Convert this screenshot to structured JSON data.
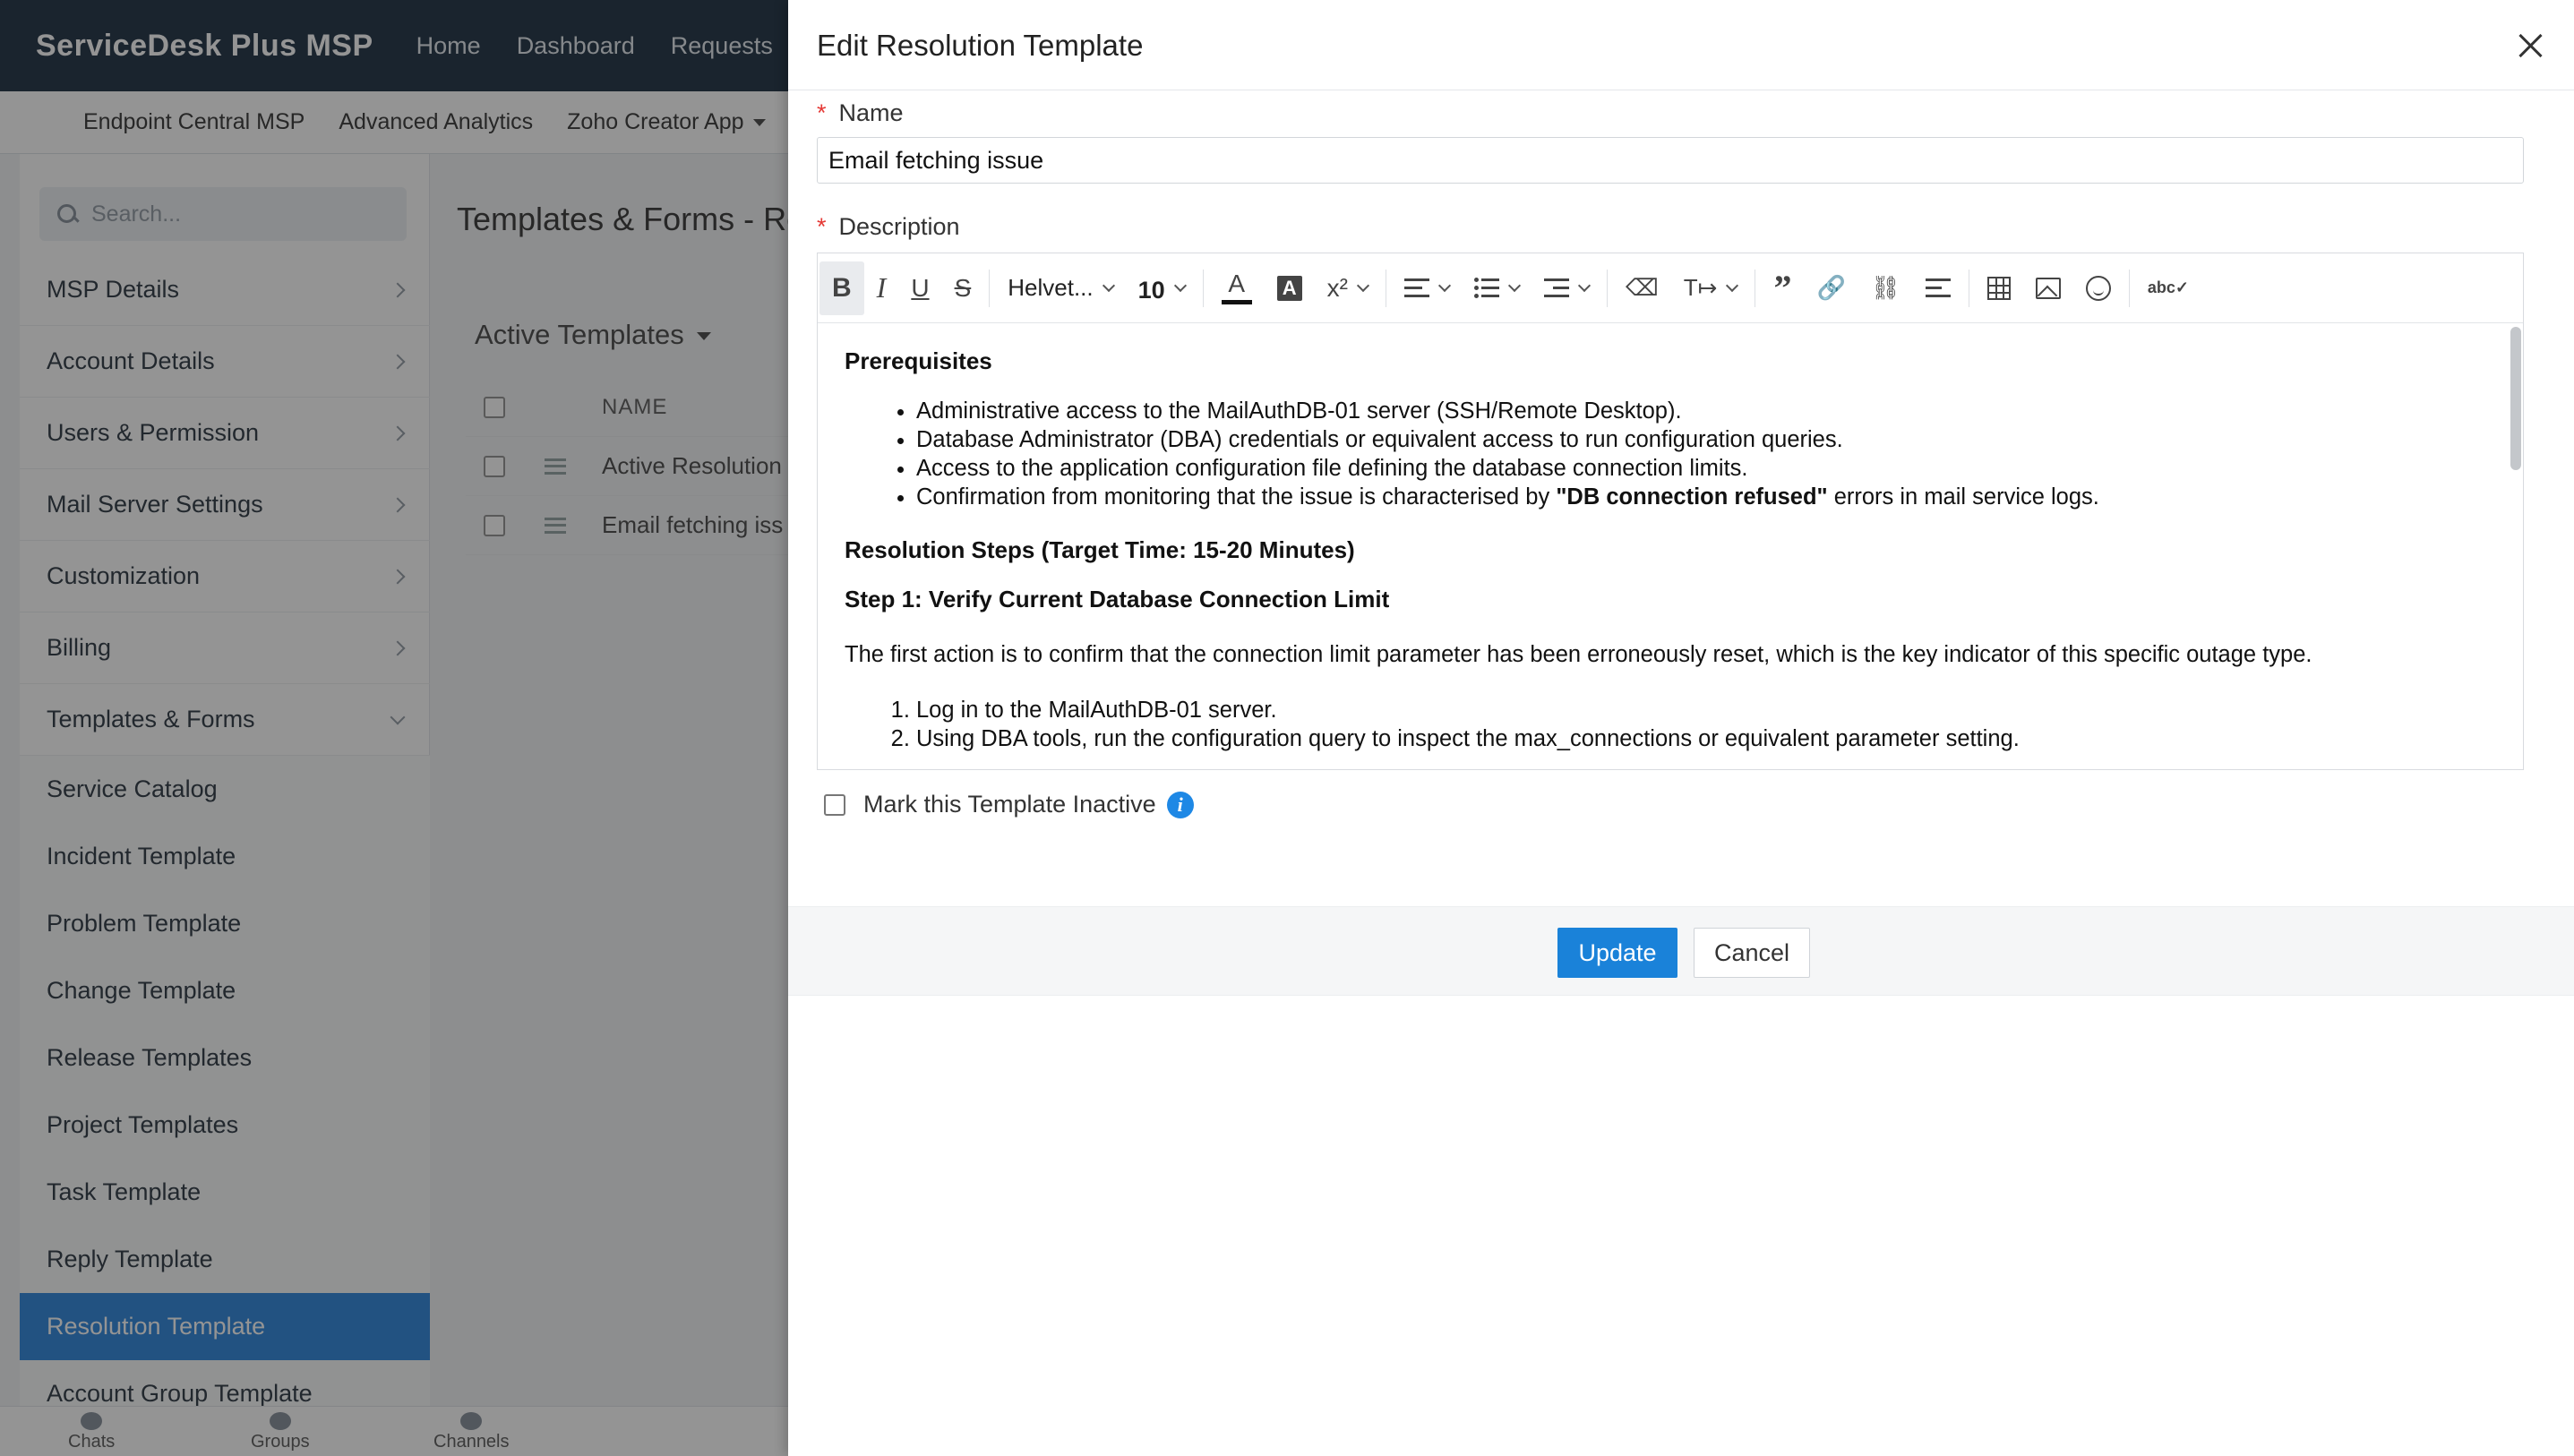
{
  "app": {
    "brand": "ServiceDesk Plus MSP",
    "top_nav": [
      "Home",
      "Dashboard",
      "Requests"
    ],
    "sub_nav": [
      "Endpoint Central MSP",
      "Advanced Analytics",
      "Zoho Creator App"
    ]
  },
  "sidebar": {
    "search_placeholder": "Search...",
    "items": [
      {
        "label": "MSP Details"
      },
      {
        "label": "Account Details"
      },
      {
        "label": "Users & Permission"
      },
      {
        "label": "Mail Server Settings"
      },
      {
        "label": "Customization"
      },
      {
        "label": "Billing"
      },
      {
        "label": "Templates & Forms"
      }
    ],
    "sub_items": [
      "Service Catalog",
      "Incident Template",
      "Problem Template",
      "Change Template",
      "Release Templates",
      "Project Templates",
      "Task Template",
      "Reply Template",
      "Resolution Template",
      "Account Group Template"
    ],
    "active_sub_item": "Resolution Template"
  },
  "content": {
    "page_title": "Templates & Forms - Re",
    "filter": "Active Templates",
    "column_name": "NAME",
    "rows": [
      "Active Resolution",
      "Email fetching iss"
    ]
  },
  "bottom_bar": [
    "Chats",
    "Groups",
    "Channels"
  ],
  "modal": {
    "title": "Edit Resolution Template",
    "name_label": "Name",
    "name_value": "Email fetching issue",
    "description_label": "Description",
    "toolbar": {
      "font_name": "Helvet...",
      "font_size": "10"
    },
    "description": {
      "prereq_heading": "Prerequisites",
      "prereq_items": [
        "Administrative access to the MailAuthDB-01 server (SSH/Remote Desktop).",
        "Database Administrator (DBA) credentials or equivalent access to run configuration queries.",
        "Access to the application configuration file defining the database connection limits."
      ],
      "prereq_last_prefix": "Confirmation from monitoring that the issue is characterised by ",
      "prereq_last_bold": "\"DB connection refused\"",
      "prereq_last_suffix": " errors in mail service logs.",
      "steps_heading": "Resolution Steps (Target Time: 15-20 Minutes)",
      "step1_heading": "Step 1: Verify Current Database Connection Limit",
      "step1_text": "The first action is to confirm that the connection limit parameter has been erroneously reset, which is the key indicator of this specific outage type.",
      "step1_items": [
        "Log in to the MailAuthDB-01 server.",
        "Using DBA tools, run the configuration query to inspect the max_connections or equivalent parameter setting."
      ]
    },
    "inactive_label": "Mark this Template Inactive",
    "update_label": "Update",
    "cancel_label": "Cancel"
  }
}
